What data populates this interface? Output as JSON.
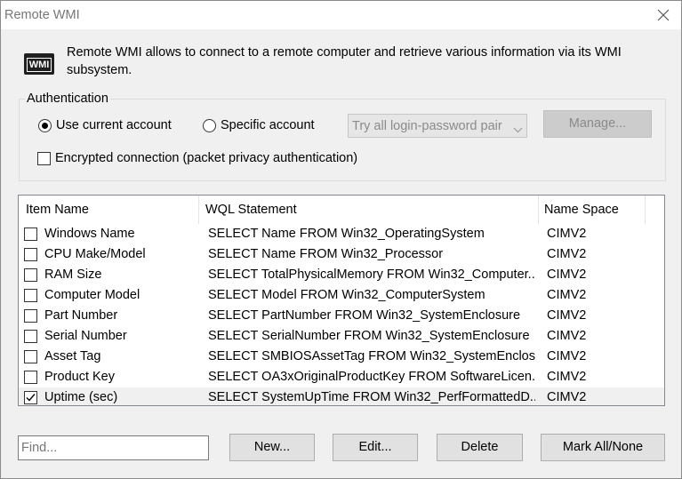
{
  "window": {
    "title": "Remote WMI",
    "close_icon": "close-icon"
  },
  "info": {
    "icon_label": "WMI",
    "text": "Remote WMI allows to connect to a remote computer and retrieve various information via its WMI subsystem."
  },
  "auth": {
    "group_label": "Authentication",
    "use_current_label": "Use current account",
    "use_current_selected": true,
    "specific_label": "Specific account",
    "specific_selected": false,
    "pair_select_value": "Try all login-password pair",
    "manage_label": "Manage...",
    "encrypted_label": "Encrypted connection (packet privacy authentication)",
    "encrypted_checked": false
  },
  "table": {
    "columns": [
      "Item Name",
      "WQL Statement",
      "Name Space"
    ],
    "rows": [
      {
        "checked": false,
        "name": "Windows Name",
        "wql": "SELECT Name FROM Win32_OperatingSystem",
        "ns": "CIMV2"
      },
      {
        "checked": false,
        "name": "CPU Make/Model",
        "wql": "SELECT Name FROM Win32_Processor",
        "ns": "CIMV2"
      },
      {
        "checked": false,
        "name": "RAM Size",
        "wql": "SELECT TotalPhysicalMemory FROM Win32_Computer...",
        "ns": "CIMV2"
      },
      {
        "checked": false,
        "name": "Computer Model",
        "wql": "SELECT Model FROM Win32_ComputerSystem",
        "ns": "CIMV2"
      },
      {
        "checked": false,
        "name": "Part Number",
        "wql": "SELECT PartNumber FROM Win32_SystemEnclosure",
        "ns": "CIMV2"
      },
      {
        "checked": false,
        "name": "Serial Number",
        "wql": "SELECT SerialNumber FROM Win32_SystemEnclosure",
        "ns": "CIMV2"
      },
      {
        "checked": false,
        "name": "Asset Tag",
        "wql": "SELECT SMBIOSAssetTag FROM Win32_SystemEnclos...",
        "ns": "CIMV2"
      },
      {
        "checked": false,
        "name": "Product Key",
        "wql": "SELECT OA3xOriginalProductKey FROM SoftwareLicen...",
        "ns": "CIMV2"
      },
      {
        "checked": true,
        "name": "Uptime (sec)",
        "wql": "SELECT SystemUpTime FROM Win32_PerfFormattedD...",
        "ns": "CIMV2",
        "selected": true
      }
    ]
  },
  "footer": {
    "find_placeholder": "Find...",
    "new_label": "New...",
    "edit_label": "Edit...",
    "delete_label": "Delete",
    "mark_label": "Mark All/None"
  }
}
